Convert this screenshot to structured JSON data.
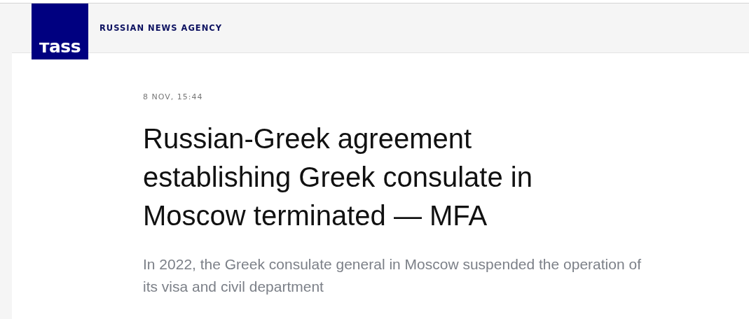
{
  "header": {
    "logo": "тass",
    "tagline": "RUSSIAN NEWS AGENCY"
  },
  "article": {
    "date": "8 NOV, 15:44",
    "headline": "Russian-Greek agreement establishing Greek consulate in Moscow terminated — MFA",
    "lead": "In 2022, the Greek consulate general in Moscow suspended the operation of its visa and civil department"
  }
}
